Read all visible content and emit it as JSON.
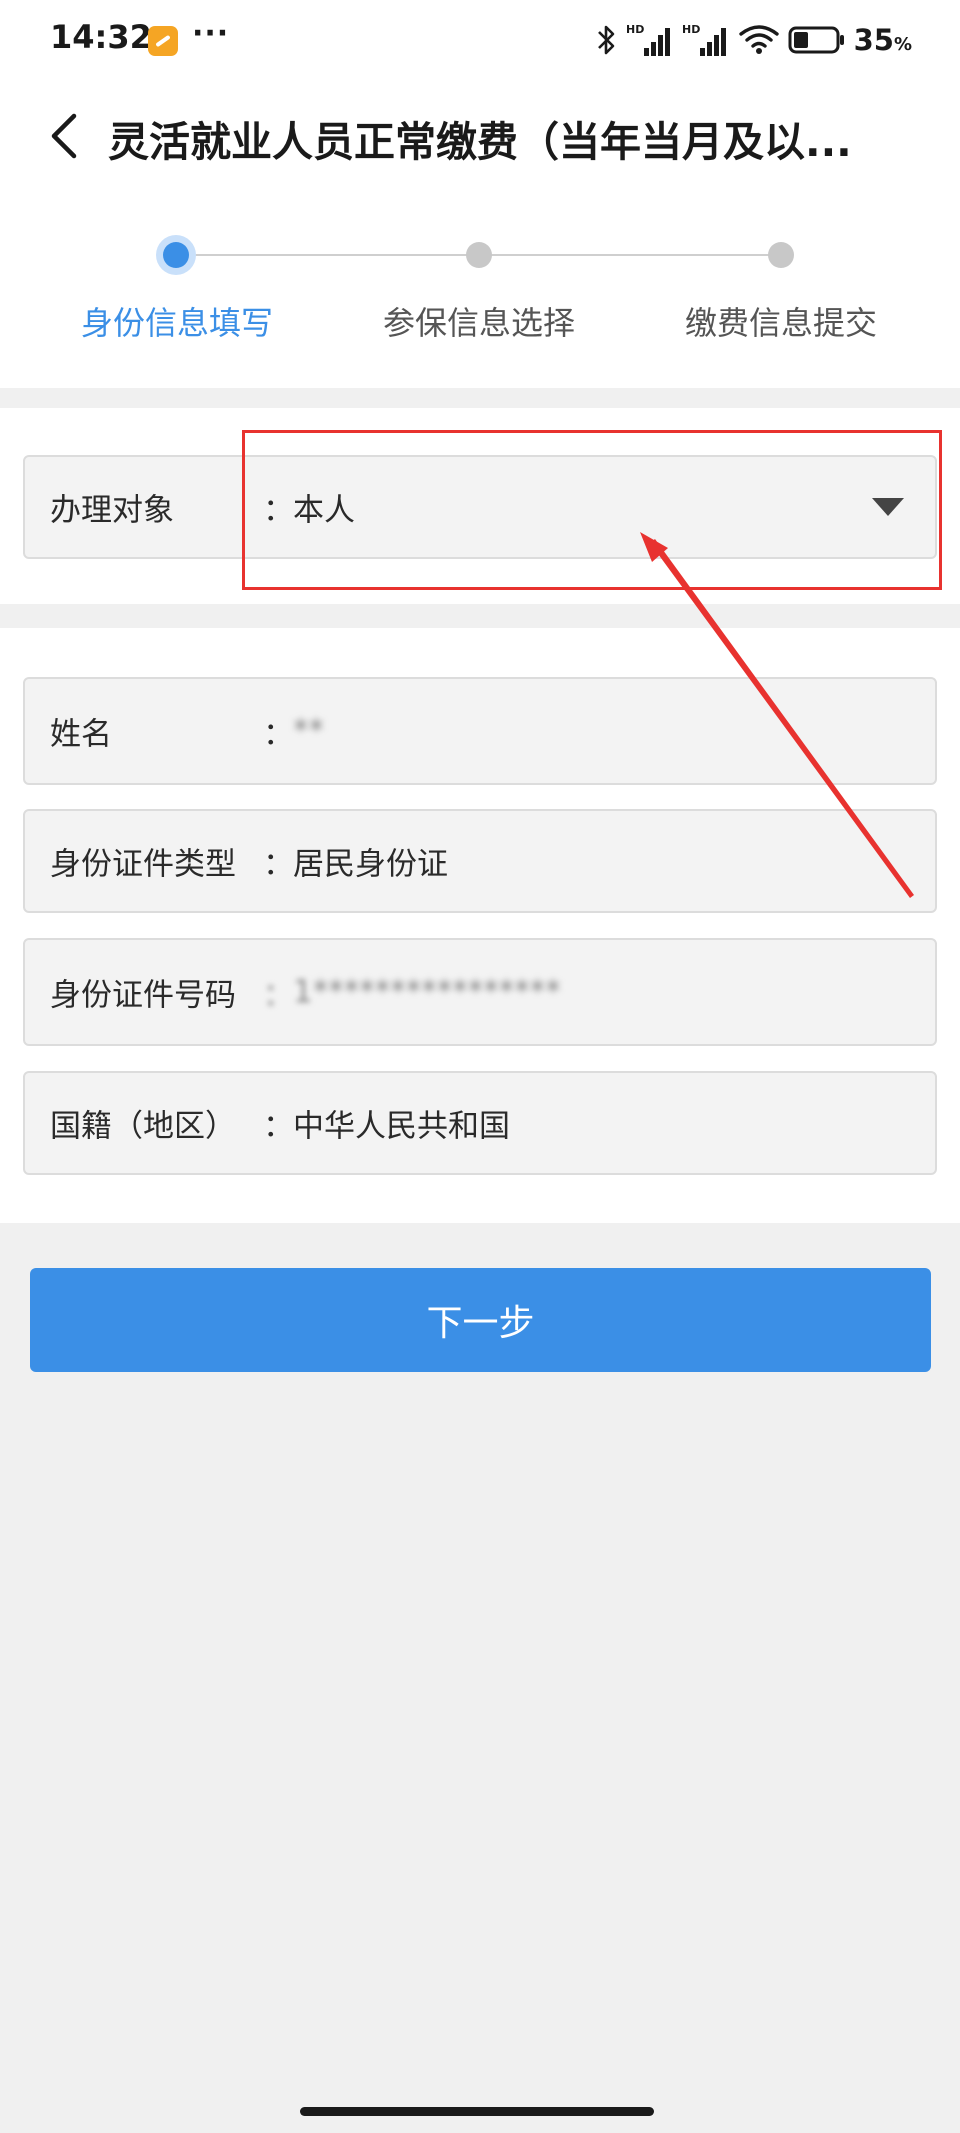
{
  "status_bar": {
    "time": "14:32",
    "more": "···",
    "battery_percent": "35",
    "battery_unit": "%",
    "battery_level": 0.35,
    "app_icon": "app-notification-icon",
    "icons": [
      "bluetooth-icon",
      "signal-icon",
      "signal-icon",
      "wifi-icon",
      "battery-icon"
    ]
  },
  "header": {
    "title": "灵活就业人员正常缴费（当年当月及以..."
  },
  "stepper": {
    "steps": [
      {
        "label": "身份信息填写",
        "active": true
      },
      {
        "label": "参保信息选择",
        "active": false
      },
      {
        "label": "缴费信息提交",
        "active": false
      }
    ],
    "accent": "#3b8fe6"
  },
  "form": {
    "colon": "：",
    "target": {
      "label": "办理对象",
      "value": "本人"
    },
    "name": {
      "label": "姓名",
      "value": "**"
    },
    "id_type": {
      "label": "身份证件类型",
      "value": "居民身份证"
    },
    "id_number": {
      "label": "身份证件号码",
      "value": "1****************"
    },
    "nationality": {
      "label": "国籍（地区）",
      "value": "中华人民共和国"
    }
  },
  "next_button": {
    "label": "下一步"
  },
  "colors": {
    "primary": "#3b8fe6",
    "annotation": "#e8322f"
  }
}
